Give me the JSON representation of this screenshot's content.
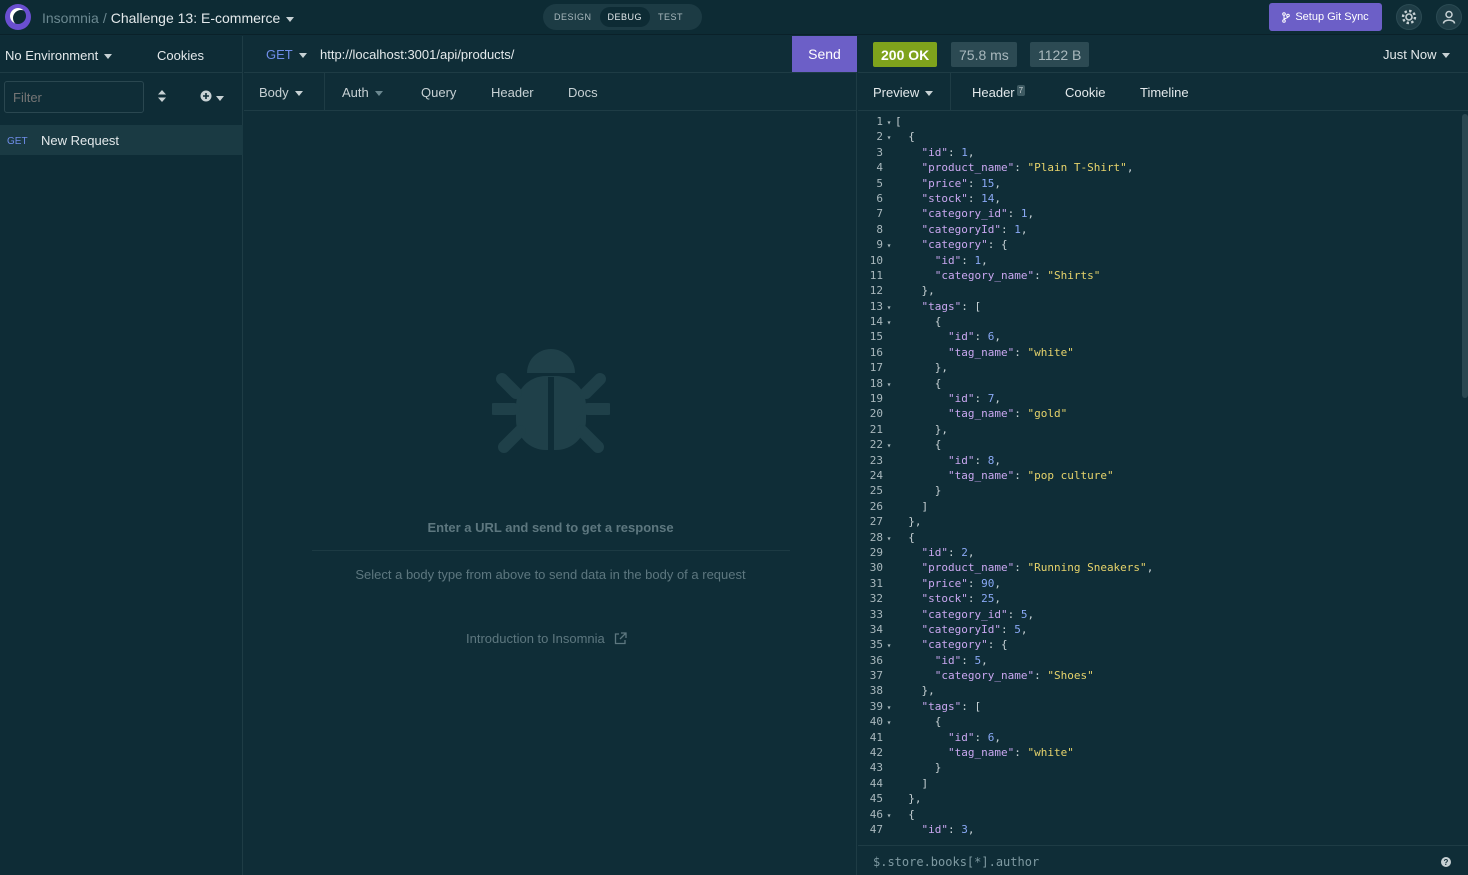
{
  "header": {
    "app_name": "Insomnia",
    "separator": "/",
    "project": "Challenge 13: E-commerce",
    "modes": [
      "DESIGN",
      "DEBUG",
      "TEST"
    ],
    "active_mode": "DEBUG",
    "git_sync_label": "Setup Git Sync",
    "icons": [
      "settings-gear-icon",
      "user-account-icon"
    ]
  },
  "sidebar": {
    "environment": "No Environment",
    "cookies": "Cookies",
    "filter_placeholder": "Filter",
    "requests": [
      {
        "method": "GET",
        "name": "New Request"
      }
    ]
  },
  "request": {
    "method": "GET",
    "url": "http://localhost:3001/api/products/",
    "send_label": "Send",
    "tabs": [
      "Body",
      "Auth",
      "Query",
      "Header",
      "Docs"
    ],
    "empty_title": "Enter a URL and send to get a response",
    "empty_sub": "Select a body type from above to send data in the body of a request",
    "intro_link": "Introduction to Insomnia"
  },
  "response": {
    "status": "200 OK",
    "time": "75.8 ms",
    "size": "1122 B",
    "when": "Just Now",
    "tabs": [
      "Preview",
      "Header",
      "Cookie",
      "Timeline"
    ],
    "header_count": "7",
    "filter_expr": "$.store.books[*].author",
    "lines": [
      {
        "n": "1",
        "fold": true,
        "t": "["
      },
      {
        "n": "2",
        "fold": true,
        "t": "  {"
      },
      {
        "n": "3",
        "t": "    \"id\": 1,"
      },
      {
        "n": "4",
        "t": "    \"product_name\": \"Plain T-Shirt\","
      },
      {
        "n": "5",
        "t": "    \"price\": 15,"
      },
      {
        "n": "6",
        "t": "    \"stock\": 14,"
      },
      {
        "n": "7",
        "t": "    \"category_id\": 1,"
      },
      {
        "n": "8",
        "t": "    \"categoryId\": 1,"
      },
      {
        "n": "9",
        "fold": true,
        "t": "    \"category\": {"
      },
      {
        "n": "10",
        "t": "      \"id\": 1,"
      },
      {
        "n": "11",
        "t": "      \"category_name\": \"Shirts\""
      },
      {
        "n": "12",
        "t": "    },"
      },
      {
        "n": "13",
        "fold": true,
        "t": "    \"tags\": ["
      },
      {
        "n": "14",
        "fold": true,
        "t": "      {"
      },
      {
        "n": "15",
        "t": "        \"id\": 6,"
      },
      {
        "n": "16",
        "t": "        \"tag_name\": \"white\""
      },
      {
        "n": "17",
        "t": "      },"
      },
      {
        "n": "18",
        "fold": true,
        "t": "      {"
      },
      {
        "n": "19",
        "t": "        \"id\": 7,"
      },
      {
        "n": "20",
        "t": "        \"tag_name\": \"gold\""
      },
      {
        "n": "21",
        "t": "      },"
      },
      {
        "n": "22",
        "fold": true,
        "t": "      {"
      },
      {
        "n": "23",
        "t": "        \"id\": 8,"
      },
      {
        "n": "24",
        "t": "        \"tag_name\": \"pop culture\""
      },
      {
        "n": "25",
        "t": "      }"
      },
      {
        "n": "26",
        "t": "    ]"
      },
      {
        "n": "27",
        "t": "  },"
      },
      {
        "n": "28",
        "fold": true,
        "t": "  {"
      },
      {
        "n": "29",
        "t": "    \"id\": 2,"
      },
      {
        "n": "30",
        "t": "    \"product_name\": \"Running Sneakers\","
      },
      {
        "n": "31",
        "t": "    \"price\": 90,"
      },
      {
        "n": "32",
        "t": "    \"stock\": 25,"
      },
      {
        "n": "33",
        "t": "    \"category_id\": 5,"
      },
      {
        "n": "34",
        "t": "    \"categoryId\": 5,"
      },
      {
        "n": "35",
        "fold": true,
        "t": "    \"category\": {"
      },
      {
        "n": "36",
        "t": "      \"id\": 5,"
      },
      {
        "n": "37",
        "t": "      \"category_name\": \"Shoes\""
      },
      {
        "n": "38",
        "t": "    },"
      },
      {
        "n": "39",
        "fold": true,
        "t": "    \"tags\": ["
      },
      {
        "n": "40",
        "fold": true,
        "t": "      {"
      },
      {
        "n": "41",
        "t": "        \"id\": 6,"
      },
      {
        "n": "42",
        "t": "        \"tag_name\": \"white\""
      },
      {
        "n": "43",
        "t": "      }"
      },
      {
        "n": "44",
        "t": "    ]"
      },
      {
        "n": "45",
        "t": "  },"
      },
      {
        "n": "46",
        "fold": true,
        "t": "  {"
      },
      {
        "n": "47",
        "t": "    \"id\": 3,"
      }
    ]
  },
  "colors": {
    "background": "#0f2d37",
    "accent": "#6c5fc7",
    "status_ok": "#7fa31c",
    "method_get": "#6f8de8",
    "json_key": "#c9a7f0",
    "json_string": "#e6d36b",
    "json_number": "#8aa9f5"
  }
}
